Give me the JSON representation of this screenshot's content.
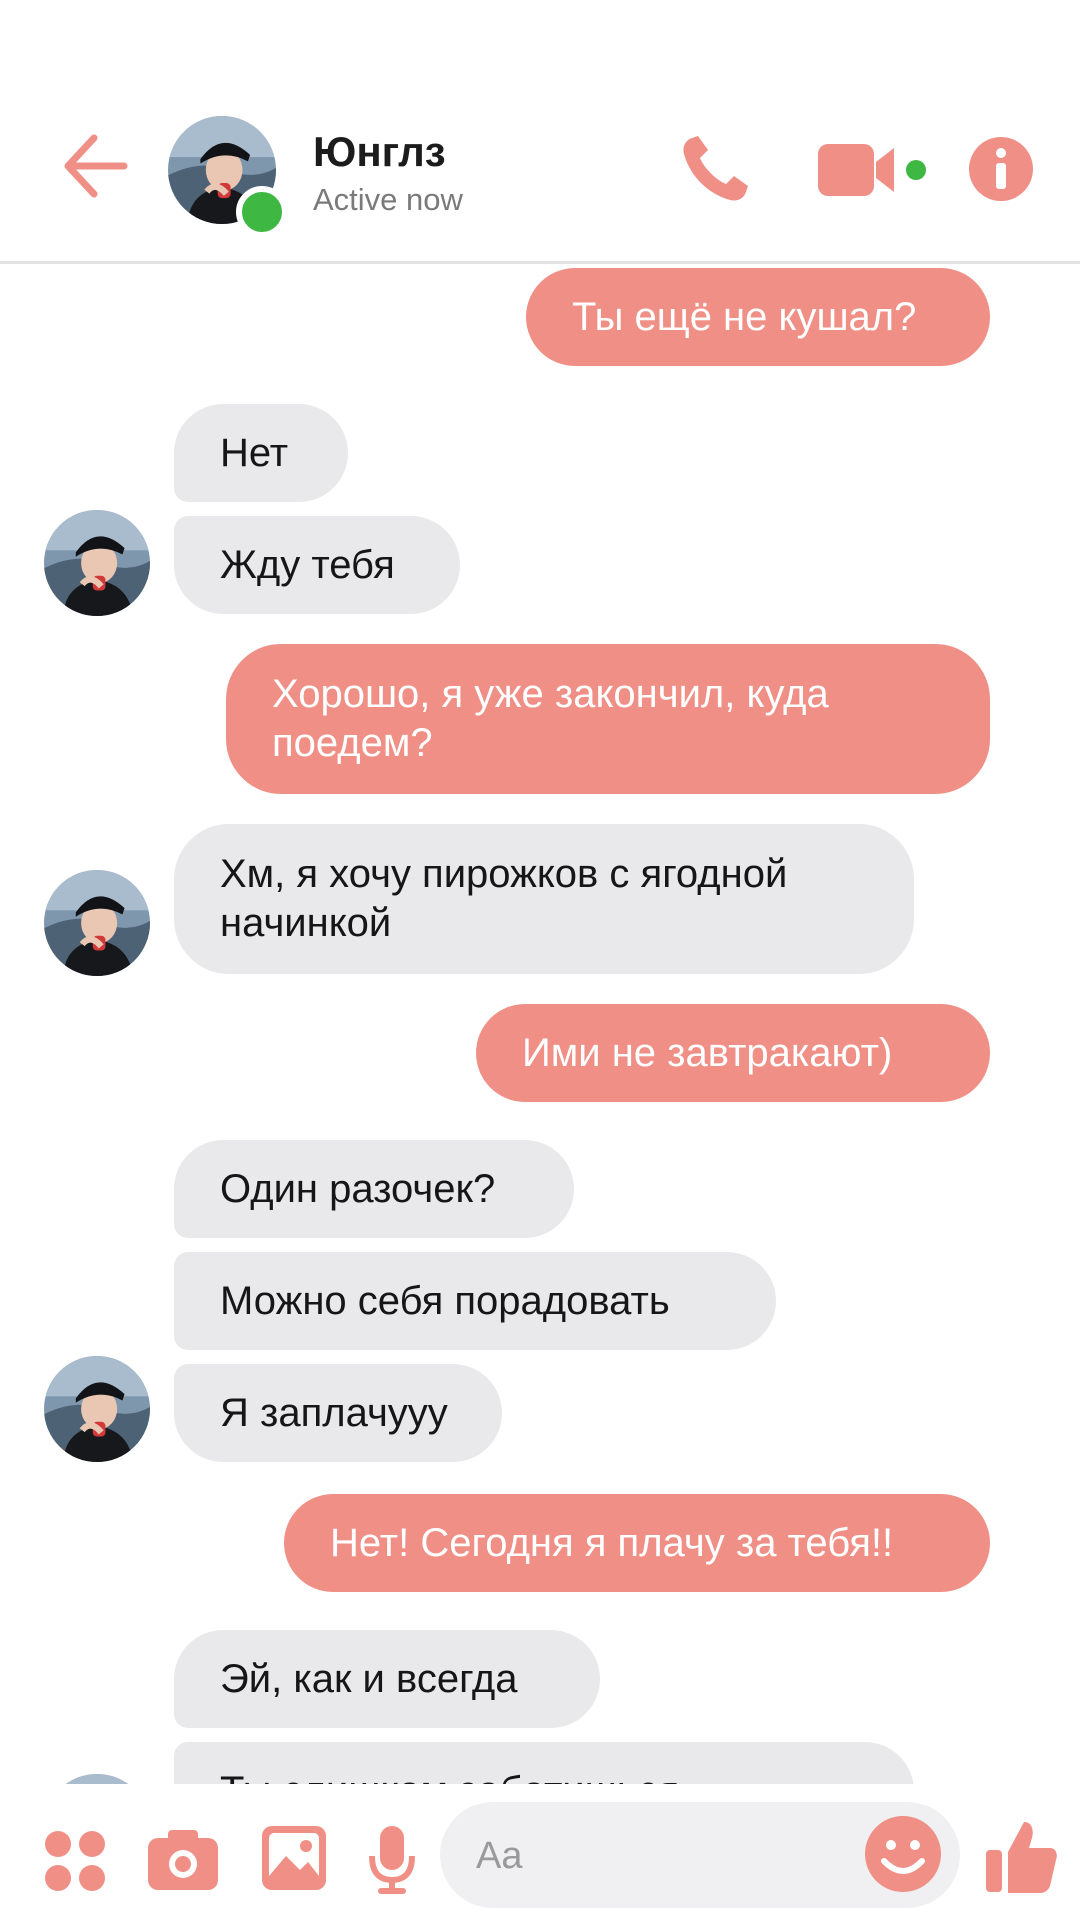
{
  "header": {
    "contact_name": "Юнглз",
    "status": "Active now"
  },
  "messages": [
    {
      "direction": "out",
      "text": "Ты ещё не кушал?"
    },
    {
      "direction": "in",
      "text": "Нет"
    },
    {
      "direction": "in",
      "text": "Жду тебя"
    },
    {
      "direction": "out",
      "text": "Хорошо, я уже закончил, куда поедем?"
    },
    {
      "direction": "in",
      "text": "Хм, я хочу пирожков с ягодной начинкой"
    },
    {
      "direction": "out",
      "text": "Ими не завтракают)"
    },
    {
      "direction": "in",
      "text": "Один разочек?"
    },
    {
      "direction": "in",
      "text": "Можно себя порадовать"
    },
    {
      "direction": "in",
      "text": "Я заплачууу"
    },
    {
      "direction": "out",
      "text": "Нет! Сегодня я плачу за тебя!!"
    },
    {
      "direction": "in",
      "text": "Эй, как и всегда"
    },
    {
      "direction": "in",
      "text": "Ты слишком заботишься"
    }
  ],
  "composer": {
    "placeholder": "Aa"
  },
  "colors": {
    "accent": "#ef8f86",
    "incoming_bubble": "#e9e9eb",
    "online": "#3fb843"
  },
  "icons": {
    "back": "arrow-left-icon",
    "call": "phone-icon",
    "video": "video-camera-icon",
    "info": "info-icon",
    "apps": "four-dots-icon",
    "camera": "camera-icon",
    "gallery": "image-icon",
    "mic": "microphone-icon",
    "emoji": "smiley-icon",
    "like": "thumbs-up-icon"
  }
}
